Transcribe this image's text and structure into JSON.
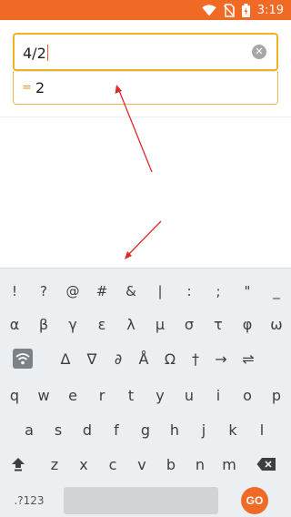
{
  "status_bar": {
    "time": "3:19",
    "icons": [
      "wifi-icon",
      "no-sim-icon",
      "battery-icon"
    ],
    "color": "#f06a26"
  },
  "calculator": {
    "expression": "4/2",
    "result_prefix": "=",
    "result": "2"
  },
  "keyboard": {
    "row1": [
      "!",
      "?",
      "@",
      "#",
      "&",
      "|",
      ":",
      ";",
      "\"",
      "_"
    ],
    "row2": [
      "α",
      "β",
      "γ",
      "ε",
      "λ",
      "μ",
      "σ",
      "τ",
      "φ",
      "ω"
    ],
    "row3": [
      "Δ",
      "∇",
      "∂",
      "Å",
      "Ω",
      "†",
      "→",
      "⇌"
    ],
    "row4": [
      "q",
      "w",
      "e",
      "r",
      "t",
      "y",
      "u",
      "i",
      "o",
      "p"
    ],
    "row5": [
      "a",
      "s",
      "d",
      "f",
      "g",
      "h",
      "j",
      "k",
      "l"
    ],
    "row6": [
      "z",
      "x",
      "c",
      "v",
      "b",
      "n",
      "m"
    ],
    "mode_key": ".?123",
    "go_key": "GO",
    "accent": "#f06a26"
  }
}
